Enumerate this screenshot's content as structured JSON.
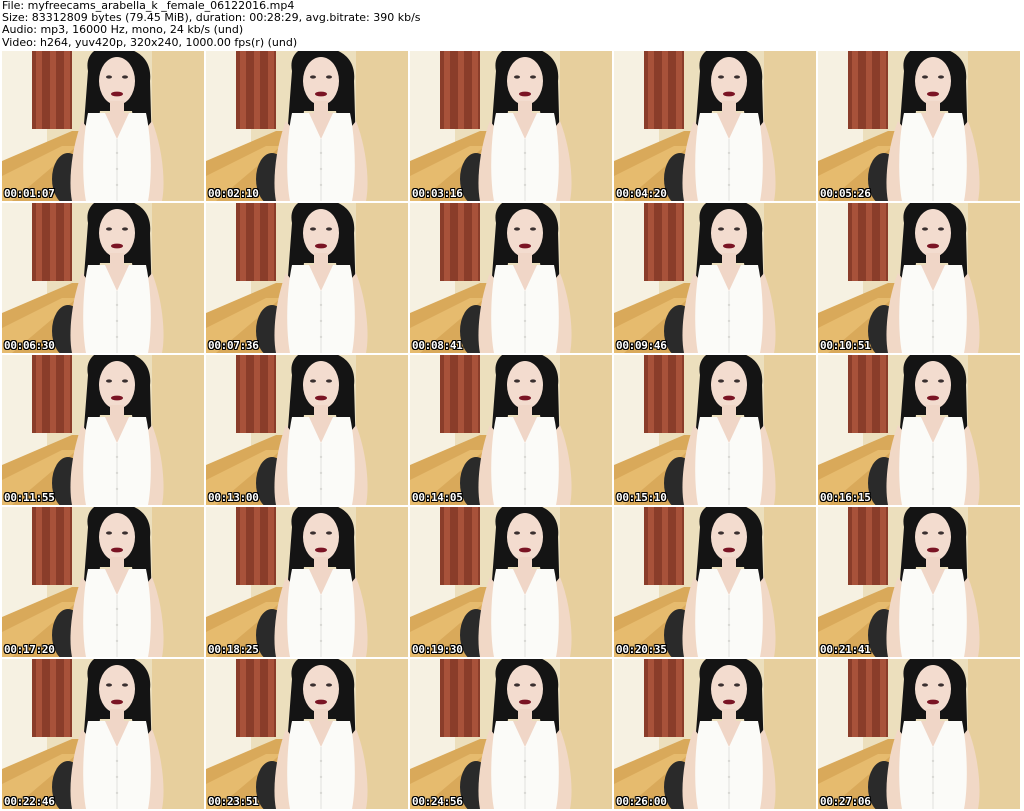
{
  "header": {
    "file_line": "File: myfreecams_arabella_k _female_06122016.mp4",
    "size_line": "Size: 83312809 bytes (79.45 MiB), duration: 00:28:29, avg.bitrate: 390 kb/s",
    "audio_line": "Audio: mp3, 16000 Hz, mono, 24 kb/s (und)",
    "video_line": "Video: h264, yuv420p, 320x240, 1000.00 fps(r) (und)"
  },
  "thumbnails": [
    {
      "timestamp": "00:01:07"
    },
    {
      "timestamp": "00:02:10"
    },
    {
      "timestamp": "00:03:16"
    },
    {
      "timestamp": "00:04:20"
    },
    {
      "timestamp": "00:05:26"
    },
    {
      "timestamp": "00:06:30"
    },
    {
      "timestamp": "00:07:36"
    },
    {
      "timestamp": "00:08:41"
    },
    {
      "timestamp": "00:09:46"
    },
    {
      "timestamp": "00:10:51"
    },
    {
      "timestamp": "00:11:55"
    },
    {
      "timestamp": "00:13:00"
    },
    {
      "timestamp": "00:14:05"
    },
    {
      "timestamp": "00:15:10"
    },
    {
      "timestamp": "00:16:15"
    },
    {
      "timestamp": "00:17:20"
    },
    {
      "timestamp": "00:18:25"
    },
    {
      "timestamp": "00:19:30"
    },
    {
      "timestamp": "00:20:35"
    },
    {
      "timestamp": "00:21:41"
    },
    {
      "timestamp": "00:22:46"
    },
    {
      "timestamp": "00:23:51"
    },
    {
      "timestamp": "00:24:56"
    },
    {
      "timestamp": "00:26:00"
    },
    {
      "timestamp": "00:27:06"
    }
  ]
}
